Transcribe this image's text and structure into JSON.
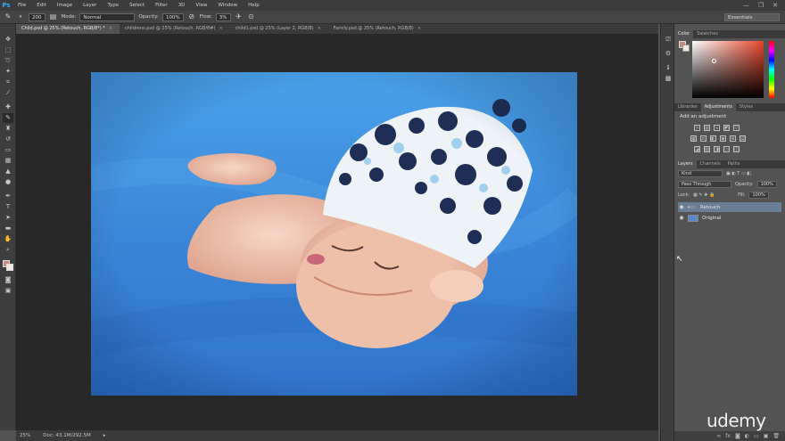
{
  "menubar": {
    "logo": "Ps",
    "items": [
      "File",
      "Edit",
      "Image",
      "Layer",
      "Type",
      "Select",
      "Filter",
      "3D",
      "View",
      "Window",
      "Help"
    ],
    "window_controls": [
      "—",
      "❐",
      "✕"
    ]
  },
  "options": {
    "brush_size": "200",
    "mode_label": "Mode:",
    "mode_value": "Normal",
    "opacity_label": "Opacity:",
    "opacity_value": "100%",
    "flow_label": "Flow:",
    "flow_value": "3%",
    "workspace": "Essentials"
  },
  "tabs": [
    {
      "label": "Child.psd @ 25% (Retouch, RGB/8*) *"
    },
    {
      "label": "childrens.psd @ 25% (Retouch, RGB/8#)"
    },
    {
      "label": "child1.psd @ 25% (Layer 2, RGB/8)"
    },
    {
      "label": "Family.psd @ 25% (Retouch, RGB/8)"
    }
  ],
  "status": {
    "zoom": "25%",
    "doc_info": "Doc: 43.1M/292.5M"
  },
  "color_panel": {
    "tabs": [
      "Color",
      "Swatches"
    ],
    "foreground": "#c88a7c",
    "background": "#f2e6e0"
  },
  "adjustments_panel": {
    "tabs": [
      "Libraries",
      "Adjustments",
      "Styles"
    ],
    "title": "Add an adjustment"
  },
  "layers_panel": {
    "tabs": [
      "Layers",
      "Channels",
      "Paths"
    ],
    "kind": "Kind",
    "blend_mode": "Pass Through",
    "opacity_label": "Opacity:",
    "opacity_value": "100%",
    "lock_label": "Lock:",
    "fill_label": "Fill:",
    "fill_value": "100%",
    "layers": [
      {
        "name": "Retouch",
        "type": "group",
        "selected": true
      },
      {
        "name": "Original",
        "type": "image",
        "selected": false
      }
    ]
  },
  "watermark": "udemy",
  "colors": {
    "accent": "#31a8ff",
    "selection": "#6a7d96",
    "blanket": "#3b86d8"
  }
}
